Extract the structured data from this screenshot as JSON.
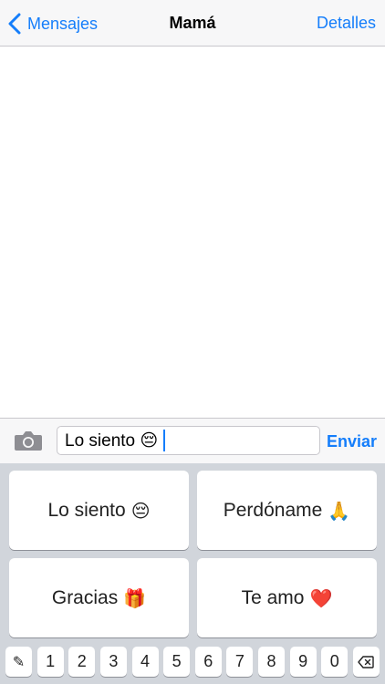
{
  "navbar": {
    "back_label": "Mensajes",
    "title": "Mamá",
    "right_label": "Detalles"
  },
  "input_bar": {
    "text_value": "Lo siento 😔",
    "send_label": "Enviar"
  },
  "keyboard": {
    "phrases": [
      {
        "text": "Lo siento",
        "emoji": "😔"
      },
      {
        "text": "Perdóname",
        "emoji": "🙏"
      },
      {
        "text": "Gracias",
        "emoji": "🎁"
      },
      {
        "text": "Te amo",
        "emoji": "❤️"
      }
    ],
    "edit_key": "✎",
    "digits": [
      "1",
      "2",
      "3",
      "4",
      "5",
      "6",
      "7",
      "8",
      "9",
      "0"
    ],
    "delete_icon": "backspace-icon"
  },
  "colors": {
    "accent": "#157efb",
    "bar_bg": "#f7f7f8",
    "keyboard_bg": "#d1d5db"
  }
}
